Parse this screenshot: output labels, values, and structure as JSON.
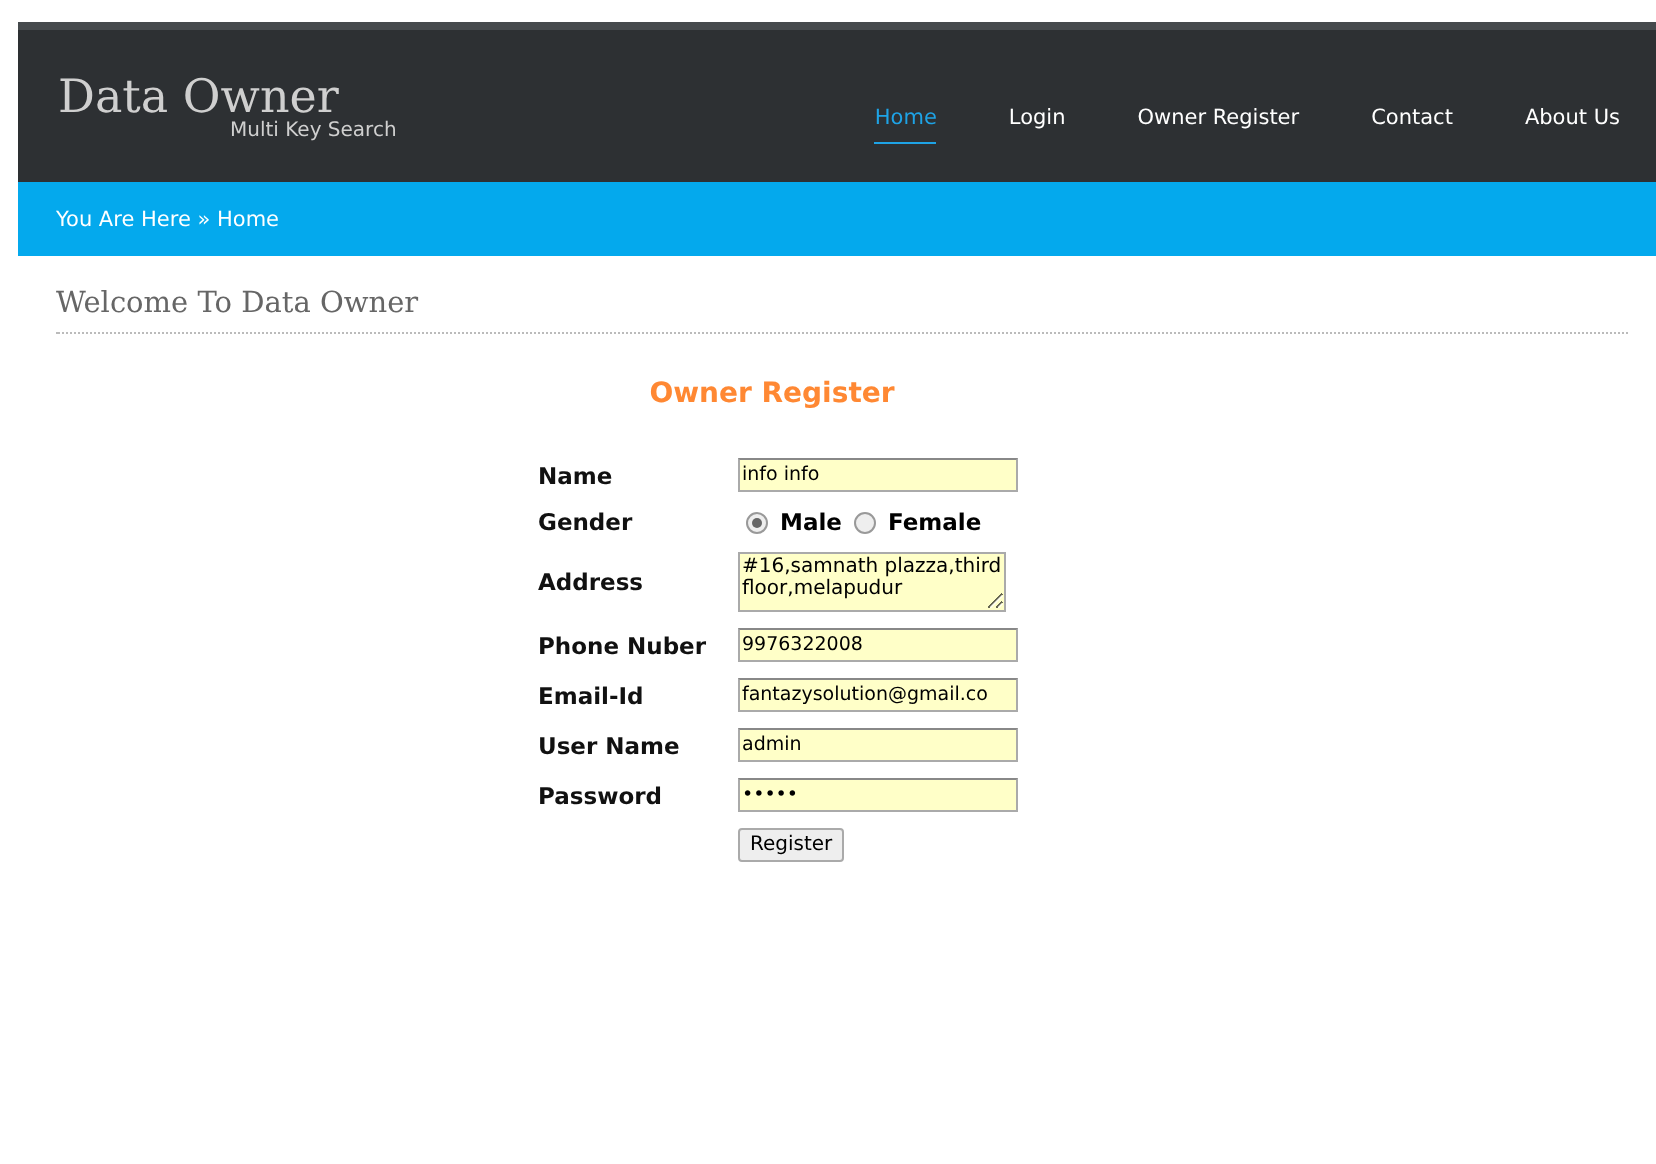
{
  "header": {
    "title": "Data Owner",
    "subtitle": "Multi Key Search"
  },
  "nav": [
    {
      "label": "Home",
      "selected": true
    },
    {
      "label": "Login",
      "selected": false
    },
    {
      "label": "Owner Register",
      "selected": false
    },
    {
      "label": "Contact",
      "selected": false
    },
    {
      "label": "About Us",
      "selected": false
    }
  ],
  "breadcrumb": "You Are Here » Home",
  "page_title": "Welcome To Data Owner",
  "form": {
    "title": "Owner Register",
    "fields": [
      {
        "kind": "text",
        "label": "Name",
        "value": "info info"
      },
      {
        "kind": "radio",
        "label": "Gender",
        "options": [
          {
            "label": "Male",
            "selected": true
          },
          {
            "label": "Female",
            "selected": false
          }
        ]
      },
      {
        "kind": "textarea",
        "label": "Address",
        "value": "#16,samnath plazza,third floor,melapudur"
      },
      {
        "kind": "text",
        "label": "Phone Nuber",
        "value": "9976322008"
      },
      {
        "kind": "text",
        "label": "Email-Id",
        "value": "fantazysolution@gmail.co"
      },
      {
        "kind": "text",
        "label": "User Name",
        "value": "admin"
      },
      {
        "kind": "text",
        "label": "Password",
        "value": "•••••"
      }
    ],
    "submit": "Register"
  }
}
